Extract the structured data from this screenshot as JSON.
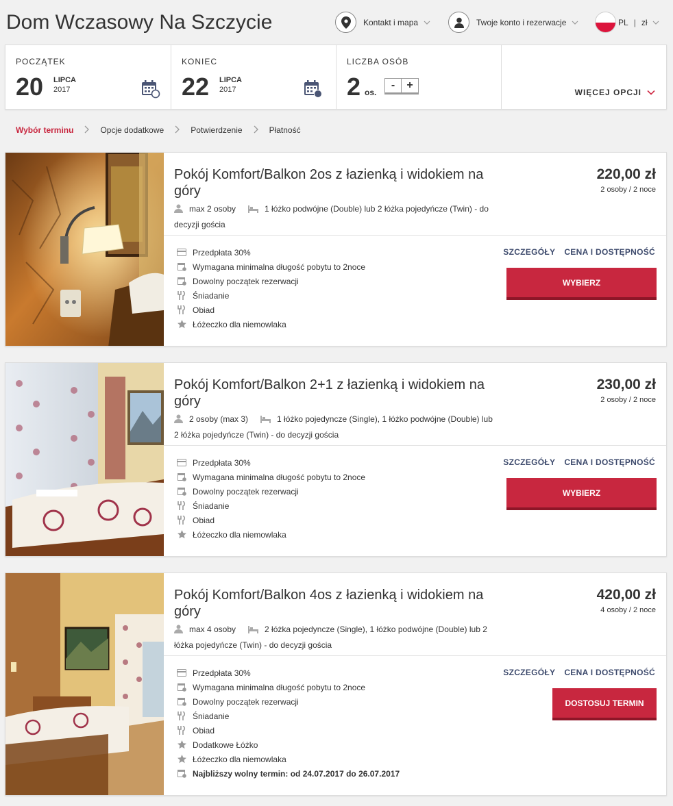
{
  "header": {
    "hotel_name": "Dom Wczasowy Na Szczycie",
    "contact_label": "Kontakt i mapa",
    "account_label": "Twoje konto i rezerwacje",
    "language": "PL",
    "separator": "|",
    "currency": "zł"
  },
  "search": {
    "start": {
      "label": "POCZĄTEK",
      "day": "20",
      "month": "LIPCA",
      "year": "2017"
    },
    "end": {
      "label": "KONIEC",
      "day": "22",
      "month": "LIPCA",
      "year": "2017"
    },
    "people": {
      "label": "LICZBA OSÓB",
      "count": "2",
      "unit": "os.",
      "minus": "-",
      "plus": "+"
    },
    "more_options": "WIĘCEJ OPCJI"
  },
  "breadcrumb": {
    "steps": [
      "Wybór terminu",
      "Opcje dodatkowe",
      "Potwierdzenie",
      "Płatność"
    ]
  },
  "rooms": [
    {
      "title": "Pokój Komfort/Balkon 2os z łazienką i widokiem na góry",
      "capacity": "max 2 osoby",
      "beds": "1 łóżko podwójne (Double) lub 2 łóżka pojedyńcze (Twin) - do decyzji gościa",
      "price": "220,00 zł",
      "price_note": "2 osoby / 2 noce",
      "features": [
        {
          "icon": "credit-card-icon",
          "text": "Przedpłata 30%"
        },
        {
          "icon": "calendar-icon",
          "text": "Wymagana minimalna długość pobytu to 2noce"
        },
        {
          "icon": "calendar-icon",
          "text": "Dowolny początek rezerwacji"
        },
        {
          "icon": "cutlery-icon",
          "text": "Śniadanie"
        },
        {
          "icon": "cutlery-icon",
          "text": "Obiad"
        },
        {
          "icon": "star-icon",
          "text": "Łóżeczko dla niemowlaka"
        }
      ],
      "details_link": "SZCZEGÓŁY",
      "availability_link": "CENA I DOSTĘPNOŚĆ",
      "button": "WYBIERZ"
    },
    {
      "title": "Pokój Komfort/Balkon 2+1 z łazienką i widokiem na góry",
      "capacity": "2 osoby (max 3)",
      "beds": "1 łóżko pojedyncze (Single), 1 łóżko podwójne (Double) lub 2 łóżka pojedyńcze (Twin) - do decyzji gościa",
      "price": "230,00 zł",
      "price_note": "2 osoby / 2 noce",
      "features": [
        {
          "icon": "credit-card-icon",
          "text": "Przedpłata 30%"
        },
        {
          "icon": "calendar-icon",
          "text": "Wymagana minimalna długość pobytu to 2noce"
        },
        {
          "icon": "calendar-icon",
          "text": "Dowolny początek rezerwacji"
        },
        {
          "icon": "cutlery-icon",
          "text": "Śniadanie"
        },
        {
          "icon": "cutlery-icon",
          "text": "Obiad"
        },
        {
          "icon": "star-icon",
          "text": "Łóżeczko dla niemowlaka"
        }
      ],
      "details_link": "SZCZEGÓŁY",
      "availability_link": "CENA I DOSTĘPNOŚĆ",
      "button": "WYBIERZ"
    },
    {
      "title": "Pokój Komfort/Balkon 4os z łazienką i widokiem na góry",
      "capacity": "max 4 osoby",
      "beds": "2 łóżka pojedyncze (Single), 1 łóżko podwójne (Double) lub 2 łóżka pojedyńcze (Twin) - do decyzji gościa",
      "price": "420,00 zł",
      "price_note": "4 osoby / 2 noce",
      "features": [
        {
          "icon": "credit-card-icon",
          "text": "Przedpłata 30%"
        },
        {
          "icon": "calendar-icon",
          "text": "Wymagana minimalna długość pobytu to 2noce"
        },
        {
          "icon": "calendar-icon",
          "text": "Dowolny początek rezerwacji"
        },
        {
          "icon": "cutlery-icon",
          "text": "Śniadanie"
        },
        {
          "icon": "cutlery-icon",
          "text": "Obiad"
        },
        {
          "icon": "star-icon",
          "text": "Dodatkowe Łóżko"
        },
        {
          "icon": "star-icon",
          "text": "Łóżeczko dla niemowlaka"
        },
        {
          "icon": "calendar-icon",
          "text": "Najbliższy wolny termin: od 24.07.2017 do 26.07.2017"
        }
      ],
      "details_link": "SZCZEGÓŁY",
      "availability_link": "CENA I DOSTĘPNOŚĆ",
      "button": "DOSTOSUJ TERMIN"
    }
  ]
}
